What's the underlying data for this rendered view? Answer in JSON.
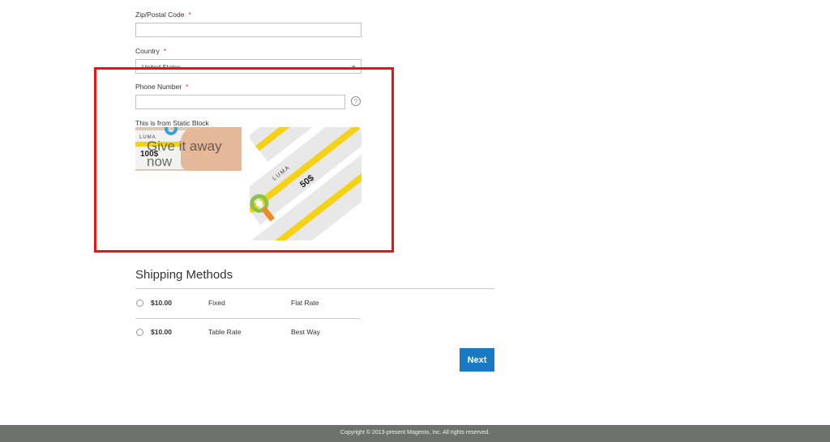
{
  "form": {
    "zip": {
      "label": "Zip/Postal Code",
      "required_mark": "*",
      "value": ""
    },
    "country": {
      "label": "Country",
      "required_mark": "*",
      "selected": "United States"
    },
    "phone": {
      "label": "Phone Number",
      "required_mark": "*",
      "value": "",
      "help_glyph": "?"
    }
  },
  "static_block": {
    "title": "This is from Static Block",
    "giveaway_image": {
      "caption": "Give it away now",
      "card_brand": "LUMA",
      "card_amount": "100$"
    },
    "gift_cards_image": {
      "brand": "LUMA",
      "amount": "50$"
    }
  },
  "shipping": {
    "title": "Shipping Methods",
    "methods": [
      {
        "price": "$10.00",
        "method": "Fixed",
        "carrier": "Flat Rate"
      },
      {
        "price": "$10.00",
        "method": "Table Rate",
        "carrier": "Best Way"
      }
    ]
  },
  "actions": {
    "next_label": "Next"
  },
  "footer": {
    "copyright": "Copyright © 2013-present Magento, Inc. All rights reserved."
  },
  "colors": {
    "accent": "#1979c3",
    "required": "#e02b27",
    "highlight_box": "#ee1111",
    "footer_bg": "#6e716e"
  }
}
